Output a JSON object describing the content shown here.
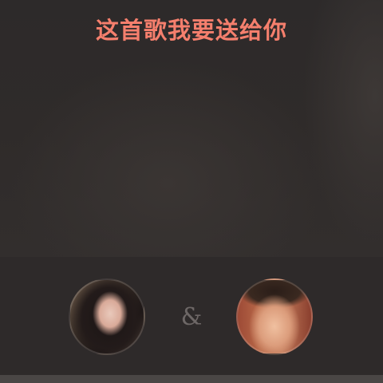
{
  "screen": {
    "title": "这首歌我要送给你"
  },
  "couple": {
    "separator": "&",
    "sender_avatar": "female-avatar-photo",
    "receiver_avatar": "male-avatar-photo"
  },
  "colors": {
    "title": "#f57f6d",
    "background": "#2c2929",
    "separator": "#6d6766"
  }
}
